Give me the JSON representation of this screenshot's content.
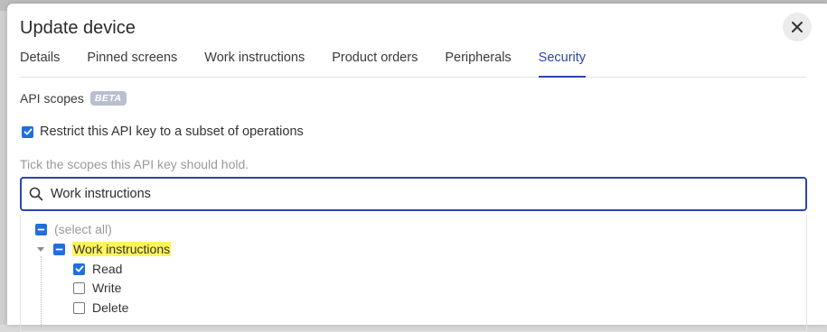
{
  "dialog": {
    "title": "Update device"
  },
  "tabs": [
    {
      "label": "Details",
      "active": false
    },
    {
      "label": "Pinned screens",
      "active": false
    },
    {
      "label": "Work instructions",
      "active": false
    },
    {
      "label": "Product orders",
      "active": false
    },
    {
      "label": "Peripherals",
      "active": false
    },
    {
      "label": "Security",
      "active": true
    }
  ],
  "security": {
    "section_label": "API scopes",
    "badge": "BETA",
    "restrict_label": "Restrict this API key to a subset of operations",
    "restrict_checked": true,
    "hint": "Tick the scopes this API key should hold.",
    "search_value": "Work instructions",
    "tree": {
      "select_all_label": "(select all)",
      "group_label": "Work instructions",
      "items": [
        {
          "label": "Read",
          "checked": true
        },
        {
          "label": "Write",
          "checked": false
        },
        {
          "label": "Delete",
          "checked": false
        }
      ]
    }
  },
  "colors": {
    "accent": "#2c46a8",
    "checkbox": "#1f6fe0",
    "highlight": "#fff45a"
  },
  "icons": {
    "close": "close-icon",
    "search": "search-icon",
    "caret": "caret-down-icon"
  }
}
